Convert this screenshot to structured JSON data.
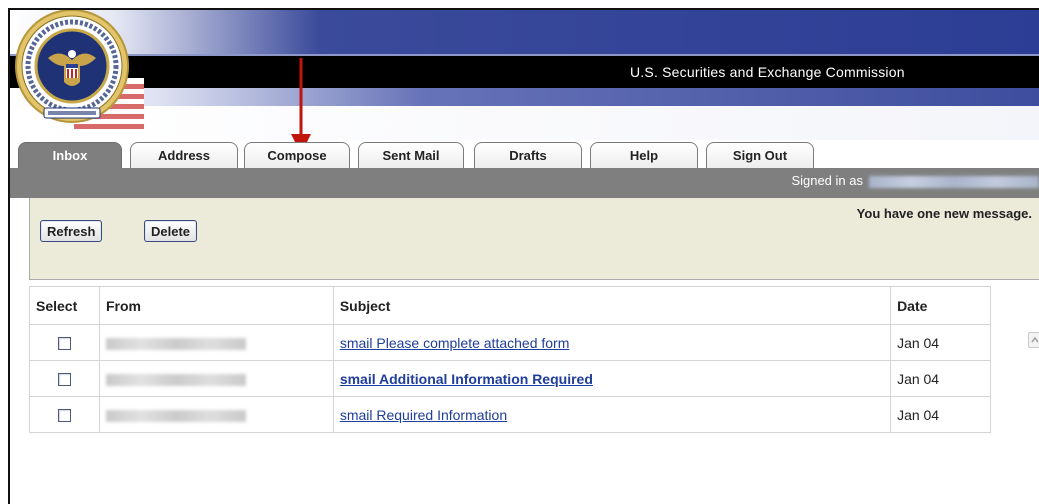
{
  "header": {
    "agency_name": "U.S. Securities and Exchange Commission"
  },
  "tabs": [
    {
      "label": "Inbox",
      "active": true
    },
    {
      "label": "Address",
      "active": false
    },
    {
      "label": "Compose",
      "active": false
    },
    {
      "label": "Sent Mail",
      "active": false
    },
    {
      "label": "Drafts",
      "active": false
    },
    {
      "label": "Help",
      "active": false
    },
    {
      "label": "Sign Out",
      "active": false
    }
  ],
  "status": {
    "signed_in_label": "Signed in as"
  },
  "toolbar": {
    "refresh_label": "Refresh",
    "delete_label": "Delete",
    "new_message_text": "You have one new message."
  },
  "table": {
    "headers": [
      "Select",
      "From",
      "Subject",
      "Date"
    ],
    "rows": [
      {
        "subject": "smail Please complete attached form",
        "date": "Jan 04",
        "unread": false
      },
      {
        "subject": "smail Additional Information Required",
        "date": "Jan 04",
        "unread": true
      },
      {
        "subject": "smail Required Information",
        "date": "Jan 04",
        "unread": false
      }
    ]
  },
  "colors": {
    "tab_active_bg": "#7f7f7f",
    "toolbar_bg": "#ecead9",
    "link": "#1f3d9a",
    "arrow": "#c0140c"
  },
  "icons": [
    "seal-logo",
    "red-arrow-annotation",
    "scroll-up-icon"
  ]
}
